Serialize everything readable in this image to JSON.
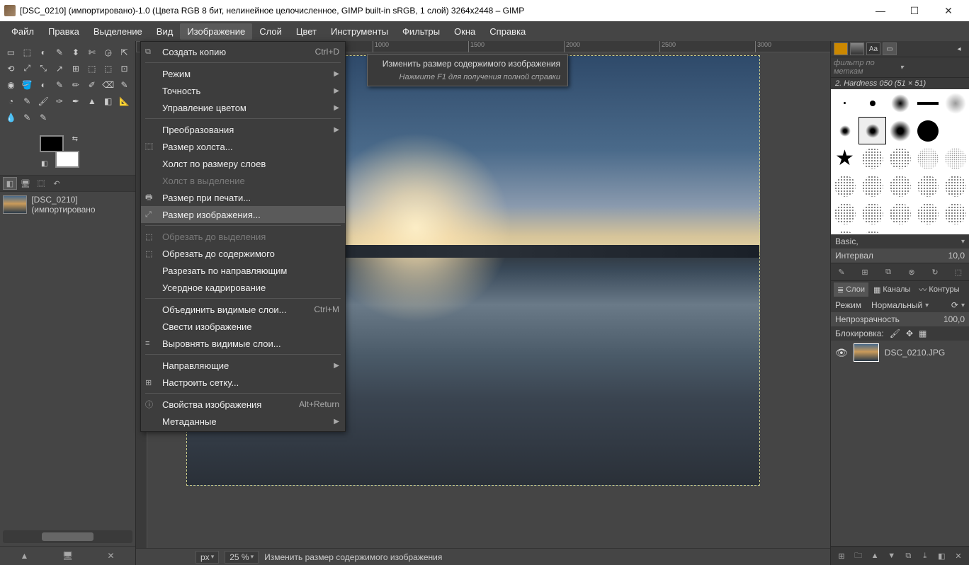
{
  "title": "[DSC_0210] (импортировано)-1.0 (Цвета RGB 8 бит, нелинейное целочисленное, GIMP built-in sRGB, 1 слой) 3264x2448 – GIMP",
  "menubar": [
    "Файл",
    "Правка",
    "Выделение",
    "Вид",
    "Изображение",
    "Слой",
    "Цвет",
    "Инструменты",
    "Фильтры",
    "Окна",
    "Справка"
  ],
  "active_menu_index": 4,
  "dropdown": {
    "items": [
      {
        "icon": "⧉",
        "label": "Создать копию",
        "shortcut": "Ctrl+D"
      },
      {
        "sep": true
      },
      {
        "label": "Режим",
        "submenu": true
      },
      {
        "label": "Точность",
        "submenu": true
      },
      {
        "label": "Управление цветом",
        "submenu": true
      },
      {
        "sep": true
      },
      {
        "label": "Преобразования",
        "submenu": true
      },
      {
        "icon": "⿴",
        "label": "Размер холста..."
      },
      {
        "label": "Холст по размеру слоев"
      },
      {
        "label": "Холст в выделение",
        "disabled": true
      },
      {
        "icon": "🖶",
        "label": "Размер при печати..."
      },
      {
        "icon": "⤢",
        "label": "Размер изображения...",
        "highlight": true
      },
      {
        "sep": true
      },
      {
        "icon": "⬚",
        "label": "Обрезать до выделения",
        "disabled": true
      },
      {
        "icon": "⬚",
        "label": "Обрезать до содержимого"
      },
      {
        "label": "Разрезать по направляющим"
      },
      {
        "label": "Усердное кадрирование"
      },
      {
        "sep": true
      },
      {
        "label": "Объединить видимые слои...",
        "shortcut": "Ctrl+M"
      },
      {
        "label": "Свести изображение"
      },
      {
        "icon": "≡",
        "label": "Выровнять видимые слои..."
      },
      {
        "sep": true
      },
      {
        "label": "Направляющие",
        "submenu": true
      },
      {
        "icon": "⊞",
        "label": "Настроить сетку..."
      },
      {
        "sep": true
      },
      {
        "icon": "ⓘ",
        "label": "Свойства изображения",
        "shortcut": "Alt+Return"
      },
      {
        "label": "Метаданные",
        "submenu": true
      }
    ]
  },
  "tooltip": {
    "title": "Изменить размер содержимого изображения",
    "sub": "Нажмите F1 для получения полной справки"
  },
  "left": {
    "image_name": "[DSC_0210] (импортировано",
    "tools": [
      [
        "▭",
        "⬚",
        "◐",
        "✎",
        "⬍",
        "✄",
        "◶",
        "⇱"
      ],
      [
        "⟲",
        "⤢",
        "⤡",
        "↗",
        "⊞",
        "⬚",
        "⬚",
        "⊡"
      ],
      [
        "◉",
        "🪣",
        "◐",
        "✎",
        "✏",
        "✐",
        "⌫",
        "✎"
      ],
      [
        "◔",
        "✎",
        "🖌",
        "✑",
        "✒",
        "▲",
        "◧",
        "📐"
      ],
      [
        "💧",
        "✎",
        "✎",
        "",
        "",
        "",
        "",
        ""
      ]
    ]
  },
  "ruler_ticks": [
    "1000",
    "1500",
    "2000",
    "2500",
    "3000"
  ],
  "right": {
    "filter_placeholder": "фильтр по меткам",
    "brush_name": "2. Hardness 050 (51 × 51)",
    "basic_label": "Basic,",
    "interval_label": "Интервал",
    "interval_value": "10,0",
    "tabs_mid": [
      {
        "icon": "≣",
        "label": "Слои"
      },
      {
        "icon": "▦",
        "label": "Каналы"
      },
      {
        "icon": "〰",
        "label": "Контуры"
      }
    ],
    "mode_label": "Режим",
    "mode_value": "Нормальный",
    "opacity_label": "Непрозрачность",
    "opacity_value": "100,0",
    "lock_label": "Блокировка:",
    "layer_name": "DSC_0210.JPG"
  },
  "statusbar": {
    "unit": "px",
    "zoom": "25 %",
    "hint": "Изменить размер содержимого изображения"
  }
}
